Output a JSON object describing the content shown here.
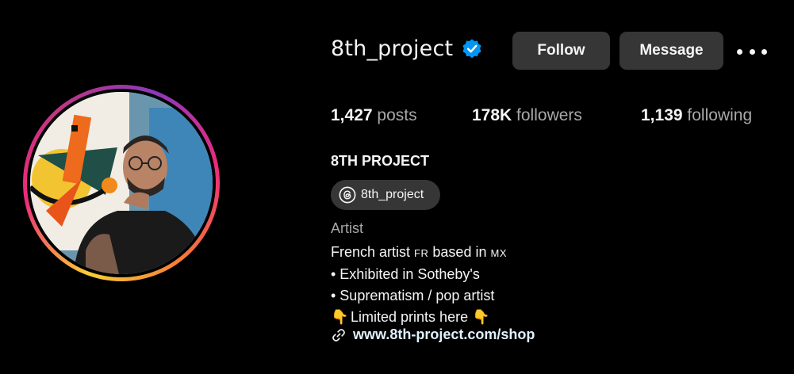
{
  "profile": {
    "username": "8th_project",
    "verified": true,
    "full_name": "8TH PROJECT",
    "threads_handle": "8th_project",
    "category": "Artist",
    "bio_line1_a": "French artist",
    "bio_line1_b": "FR",
    "bio_line1_c": "based in",
    "bio_line1_d": "MX",
    "bio_line2": "• Exhibited in Sotheby's",
    "bio_line3": "• Suprematism / pop artist",
    "bio_line4_emoji_left": "👇",
    "bio_line4_text": "Limited prints here",
    "bio_line4_emoji_right": "👇",
    "website": "www.8th-project.com/shop"
  },
  "actions": {
    "follow_label": "Follow",
    "message_label": "Message",
    "more_icon": "more-options-icon"
  },
  "stats": {
    "posts_value": "1,427",
    "posts_label": "posts",
    "followers_value": "178K",
    "followers_label": "followers",
    "following_value": "1,139",
    "following_label": "following"
  },
  "colors": {
    "background": "#000000",
    "button": "#363636",
    "verified": "#0095f6",
    "secondary_text": "#a8a8a8"
  }
}
